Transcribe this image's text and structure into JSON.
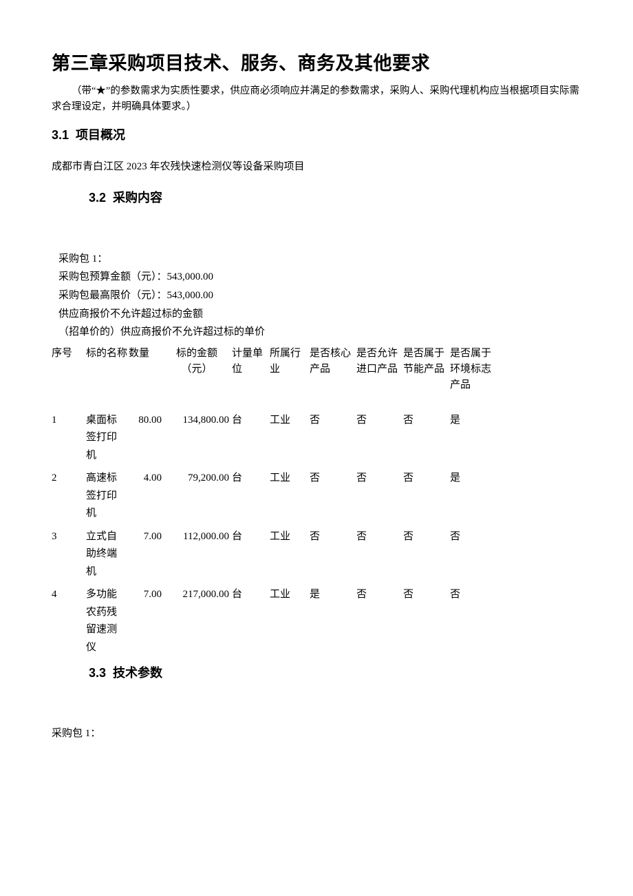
{
  "chapterTitle": "第三章采购项目技术、服务、商务及其他要求",
  "introNote": "（带“★”的参数需求为实质性要求，供应商必须响应并满足的参数需求，采购人、采购代理机构应当根据项目实际需求合理设定，并明确具体要求。）",
  "sec31": {
    "num": "3.1",
    "title": "项目概况"
  },
  "sec32": {
    "num": "3.2",
    "title": "采购内容"
  },
  "sec33": {
    "num": "3.3",
    "title": "技术参数"
  },
  "overview": "成都市青白江区 2023 年农残快速检测仪等设备采购项目",
  "pkgHeader": {
    "pkgLabel": "采购包 1：",
    "budgetLine": "采购包预算金额（元）：543,000.00",
    "ceilingLine": "采购包最高限价（元）：543,000.00",
    "rule1": "供应商报价不允许超过标的金额",
    "rule2": "（招单价的）供应商报价不允许超过标的单价"
  },
  "headers": {
    "seq": "序号",
    "name": "标的名称",
    "qty": "数量",
    "amt1": "标的金额",
    "amt2": "（元）",
    "unit": "计量单位",
    "ind": "所属行业",
    "core1": "是否核心",
    "core2": "产品",
    "imp1": "是否允许",
    "imp2": "进口产品",
    "energy1": "是否属于",
    "energy2": "节能产品",
    "env1": "是否属于",
    "env2": "环境标志",
    "env3": "产品"
  },
  "rows": [
    {
      "seq": "1",
      "nameL1": "桌面标",
      "nameL2": "签打印",
      "nameL3": "机",
      "qty": "80.00",
      "amt": "134,800.00",
      "unit": "台",
      "ind": "工业",
      "core": "否",
      "imp": "否",
      "energy": "否",
      "env": "是"
    },
    {
      "seq": "2",
      "nameL1": "高速标",
      "nameL2": "签打印",
      "nameL3": "机",
      "qty": "4.00",
      "amt": "79,200.00",
      "unit": "台",
      "ind": "工业",
      "core": "否",
      "imp": "否",
      "energy": "否",
      "env": "是"
    },
    {
      "seq": "3",
      "nameL1": "立式自",
      "nameL2": "助终端",
      "nameL3": "机",
      "qty": "7.00",
      "amt": "112,000.00",
      "unit": "台",
      "ind": "工业",
      "core": "否",
      "imp": "否",
      "energy": "否",
      "env": "否"
    },
    {
      "seq": "4",
      "nameL1": "多功能",
      "nameL2": "农药残",
      "nameL3": "留速测",
      "nameL4": "仪",
      "qty": "7.00",
      "amt": "217,000.00",
      "unit": "台",
      "ind": "工业",
      "core": "是",
      "imp": "否",
      "energy": "否",
      "env": "否"
    }
  ],
  "footerPkg": "采购包 1："
}
